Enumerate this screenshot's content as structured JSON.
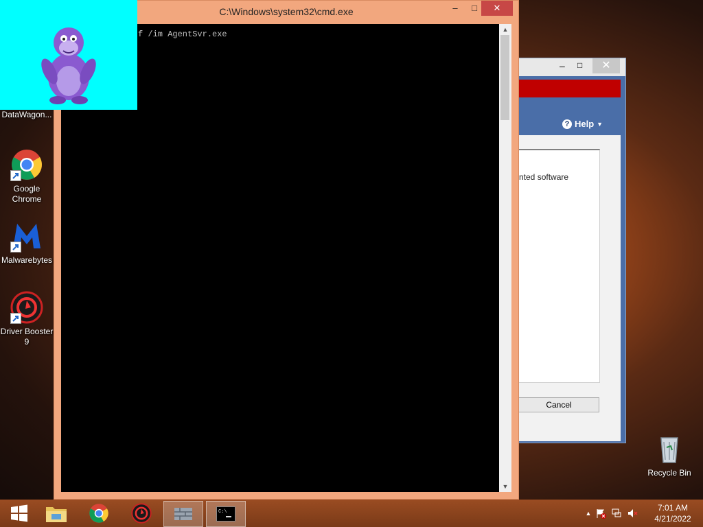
{
  "desktop": {
    "icons": [
      {
        "label": "DataWagon..."
      },
      {
        "label": "Google Chrome"
      },
      {
        "label": "Malwarebytes"
      },
      {
        "label": "Driver Booster 9"
      },
      {
        "label": "Recycle Bin"
      }
    ]
  },
  "cmd": {
    "title": "C:\\Windows\\system32\\cmd.exe",
    "console_text": "f /im AgentSvr.exe",
    "min_icon": "minimize-icon",
    "max_icon": "maximize-icon",
    "close_icon": "close-icon",
    "title_bg": "#f2a77e",
    "close_bg": "#c74746"
  },
  "installer": {
    "help_label": "Help",
    "body_text": "nted software",
    "cancel_label": "Cancel",
    "accent": "#c00000",
    "panel_bg": "#4a6ea8"
  },
  "taskbar": {
    "time": "7:01 AM",
    "date": "4/21/2022",
    "apps": [
      "windows-start-icon",
      "file-explorer-icon",
      "chrome-icon",
      "driver-booster-icon",
      "installer-icon",
      "cmd-icon"
    ]
  }
}
